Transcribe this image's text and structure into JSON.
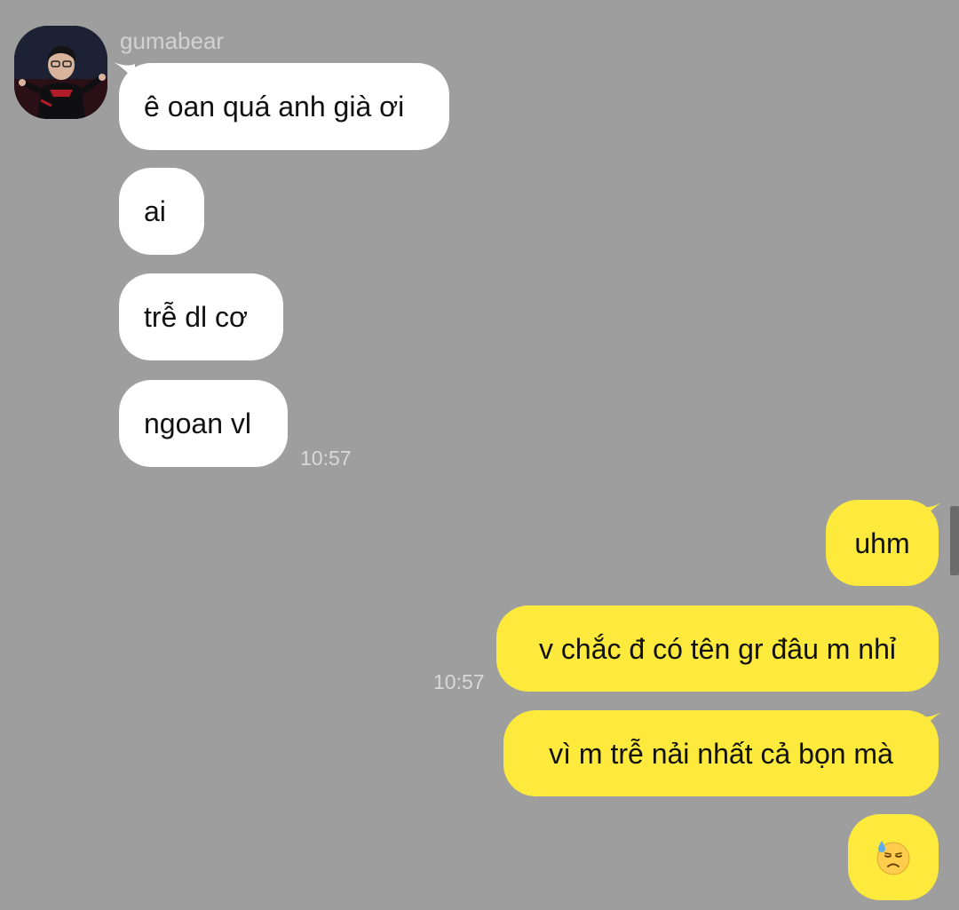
{
  "sender": {
    "name": "gumabear"
  },
  "incoming": [
    {
      "text": "ê oan quá anh già ơi"
    },
    {
      "text": "ai"
    },
    {
      "text": "trễ dl cơ"
    },
    {
      "text": "ngoan vl"
    }
  ],
  "incoming_time": "10:57",
  "outgoing": [
    {
      "text": "uhm"
    },
    {
      "text": "v chắc đ có tên gr đâu m nhỉ"
    },
    {
      "text": "vì m trễ nải nhất cả bọn mà"
    },
    {
      "emoji": "downcast-face-with-sweat-icon"
    }
  ],
  "outgoing_time": "10:57",
  "colors": {
    "background": "#9e9e9e",
    "incoming_bubble": "#ffffff",
    "outgoing_bubble": "#fdea3c",
    "timestamp": "#d9d9d9"
  }
}
